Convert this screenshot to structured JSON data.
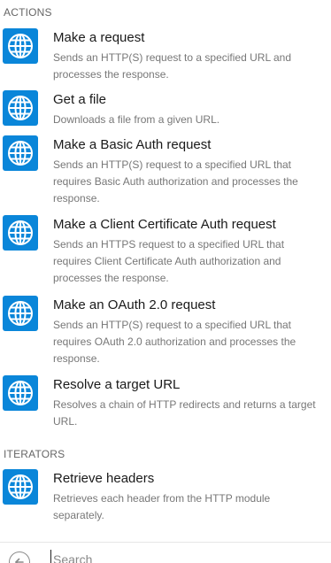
{
  "actions_header": "ACTIONS",
  "iterators_header": "ITERATORS",
  "actions": [
    {
      "icon": "globe-icon",
      "title": "Make a request",
      "description": "Sends an HTTP(S) request to a specified URL and processes the response."
    },
    {
      "icon": "globe-icon",
      "title": "Get a file",
      "description": "Downloads a file from a given URL."
    },
    {
      "icon": "globe-icon",
      "title": "Make a Basic Auth request",
      "description": "Sends an HTTP(S) request to a specified URL that requires Basic Auth authorization and processes the response."
    },
    {
      "icon": "globe-icon",
      "title": "Make a Client Certificate Auth request",
      "description": "Sends an HTTPS request to a specified URL that requires Client Certificate Auth authorization and processes the response."
    },
    {
      "icon": "globe-icon",
      "title": "Make an OAuth 2.0 request",
      "description": "Sends an HTTP(S) request to a specified URL that requires OAuth 2.0 authorization and processes the response."
    },
    {
      "icon": "globe-icon",
      "title": "Resolve a target URL",
      "description": "Resolves a chain of HTTP redirects and returns a target URL."
    }
  ],
  "iterators": [
    {
      "icon": "globe-icon",
      "title": "Retrieve headers",
      "description": "Retrieves each header from the HTTP module separately."
    }
  ],
  "search": {
    "placeholder": "Search",
    "value": ""
  },
  "colors": {
    "icon_bg": "#0a86d9",
    "title": "#1a1a1a",
    "description": "#777777",
    "header": "#666666"
  }
}
